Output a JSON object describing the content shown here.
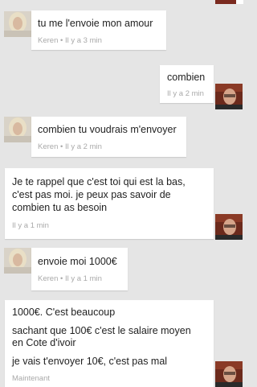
{
  "messages": [
    {
      "sender": "Keren",
      "text": "tu me l'envoie mon amour",
      "time": "Keren • Il y a 3 min"
    },
    {
      "sender": "me",
      "text": "combien",
      "time": "Il y a 2 min"
    },
    {
      "sender": "Keren",
      "text": "combien tu voudrais m'envoyer",
      "time": "Keren • Il y a 2 min"
    },
    {
      "sender": "me",
      "lines": [
        "Je te rappel que c'est toi qui est la bas,",
        "c'est pas moi. je peux pas savoir de",
        "combien tu as besoin"
      ],
      "time": "Il y a 1 min"
    },
    {
      "sender": "Keren",
      "text": "envoie  moi 1000€",
      "time": "Keren • Il y a 1 min"
    },
    {
      "sender": "me",
      "line1": "1000€. C'est beaucoup",
      "line2": "sachant que 100€ c'est le salaire moyen",
      "line3": "en Cote d'ivoir",
      "line4": "je vais t'envoyer 10€, c'est pas mal",
      "time": "Maintenant"
    }
  ],
  "colors": {
    "background": "#e5e5e5",
    "bubble": "#ffffff",
    "meta": "#a9a9a9"
  },
  "icons": {
    "keren_avatar": "avatar-keren-icon",
    "me_avatar": "avatar-me-icon"
  }
}
